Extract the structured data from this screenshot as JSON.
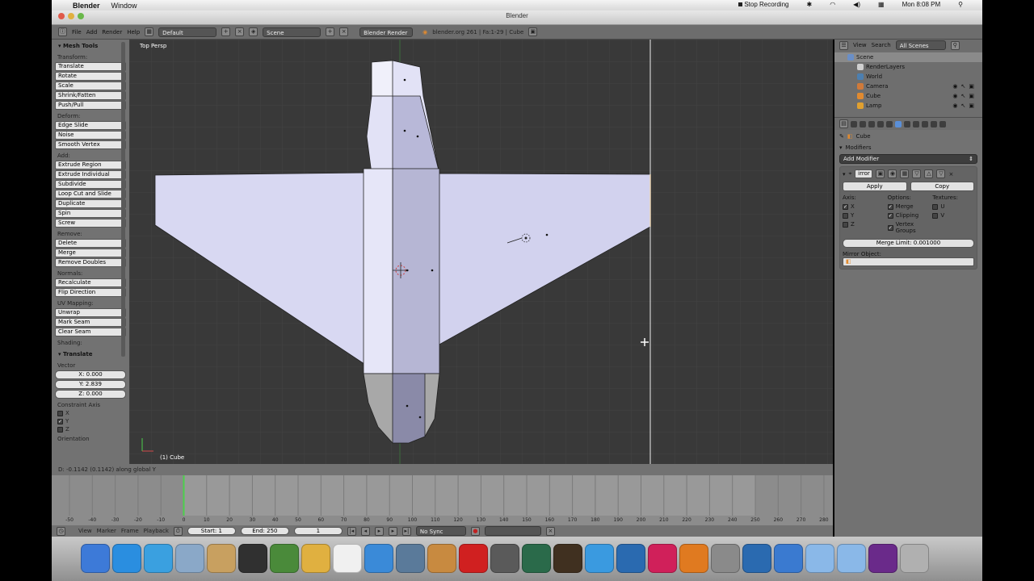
{
  "menubar": {
    "app": "Blender",
    "menu_window": "Window",
    "status": "Stop Recording",
    "clock": "Mon 8:08 PM"
  },
  "window": {
    "title": "Blender"
  },
  "info_header": {
    "menus": [
      "File",
      "Add",
      "Render",
      "Help"
    ],
    "screen_layout": "Default",
    "scene": "Scene",
    "render_engine": "Blender Render",
    "stats": "blender.org 261 | Fa:1-29 | Cube"
  },
  "toolshelf": {
    "panel_title": "Mesh Tools",
    "sections": [
      {
        "label": "Transform:",
        "buttons": [
          "Translate",
          "Rotate",
          "Scale",
          "Shrink/Fatten",
          "Push/Pull"
        ]
      },
      {
        "label": "Deform:",
        "buttons": [
          "Edge Slide",
          "Noise",
          "Smooth Vertex"
        ]
      },
      {
        "label": "Add:",
        "buttons": [
          "Extrude Region",
          "Extrude Individual",
          "Subdivide",
          "Loop Cut and Slide",
          "Duplicate",
          "Spin",
          "Screw"
        ]
      },
      {
        "label": "Remove:",
        "buttons": [
          "Delete",
          "Merge",
          "Remove Doubles"
        ]
      },
      {
        "label": "Normals:",
        "buttons": [
          "Recalculate",
          "Flip Direction"
        ]
      },
      {
        "label": "UV Mapping:",
        "buttons": [
          "Unwrap",
          "Mark Seam",
          "Clear Seam"
        ]
      },
      {
        "label": "Shading:",
        "buttons": []
      }
    ],
    "operator": {
      "title": "Translate",
      "vector_label": "Vector",
      "vector": [
        "X: 0.000",
        "Y: 2.839",
        "Z: 0.000"
      ],
      "constraint_label": "Constraint Axis",
      "constraints": [
        {
          "axis": "X",
          "checked": false
        },
        {
          "axis": "Y",
          "checked": true
        },
        {
          "axis": "Z",
          "checked": false
        }
      ],
      "orientation_label": "Orientation"
    }
  },
  "viewport": {
    "view_name": "Top Persp",
    "object_label": "(1) Cube"
  },
  "status": {
    "text": "D: -0.1142 (0.1142) along global Y"
  },
  "timeline": {
    "ticks": [
      "-50",
      "-40",
      "-30",
      "-20",
      "-10",
      "0",
      "10",
      "20",
      "30",
      "40",
      "50",
      "60",
      "70",
      "80",
      "90",
      "100",
      "110",
      "120",
      "130",
      "140",
      "150",
      "160",
      "170",
      "180",
      "190",
      "200",
      "210",
      "220",
      "230",
      "240",
      "250",
      "260",
      "270",
      "280"
    ],
    "current_frame": 0,
    "header": {
      "menus": [
        "View",
        "Marker",
        "Frame",
        "Playback"
      ],
      "start": "Start: 1",
      "end": "End: 250",
      "frame": "1",
      "sync": "No Sync"
    }
  },
  "outliner": {
    "menus": [
      "View",
      "Search"
    ],
    "filter": "All Scenes",
    "items": [
      {
        "name": "Scene",
        "icon_color": "#6a8fc8",
        "selected": true
      },
      {
        "name": "RenderLayers",
        "icon_color": "#d0d0d0",
        "selected": false
      },
      {
        "name": "World",
        "icon_color": "#4c7fb0",
        "selected": false
      },
      {
        "name": "Camera",
        "icon_color": "#d07a3a",
        "selected": false
      },
      {
        "name": "Cube",
        "icon_color": "#e08a30",
        "selected": false
      },
      {
        "name": "Lamp",
        "icon_color": "#e0a030",
        "selected": false
      }
    ]
  },
  "properties": {
    "breadcrumb": "Cube",
    "panel": "Modifiers",
    "add_modifier": "Add Modifier",
    "modifier_name": "irror",
    "apply": "Apply",
    "copy": "Copy",
    "axis_label": "Axis:",
    "options_label": "Options:",
    "textures_label": "Textures:",
    "axis": [
      {
        "name": "X",
        "checked": true
      },
      {
        "name": "Y",
        "checked": false
      },
      {
        "name": "Z",
        "checked": false
      }
    ],
    "options": [
      {
        "name": "Merge",
        "checked": true
      },
      {
        "name": "Clipping",
        "checked": true
      },
      {
        "name": "Vertex Groups",
        "checked": true
      }
    ],
    "textures": [
      {
        "name": "U",
        "checked": false
      },
      {
        "name": "V",
        "checked": false
      }
    ],
    "merge_limit": "Merge Limit: 0.001000",
    "mirror_object_label": "Mirror Object:"
  },
  "dock": {
    "icons": [
      {
        "name": "finder-icon",
        "color": "#3d7ad8"
      },
      {
        "name": "app-store-icon",
        "color": "#2a8ee0"
      },
      {
        "name": "safari-icon",
        "color": "#3aa0e0"
      },
      {
        "name": "mail-icon",
        "color": "#8aa8c8"
      },
      {
        "name": "preview-icon",
        "color": "#c8a060"
      },
      {
        "name": "dashboard-icon",
        "color": "#303030"
      },
      {
        "name": "facetime-icon",
        "color": "#4a8a3a"
      },
      {
        "name": "notes-icon",
        "color": "#e0b040"
      },
      {
        "name": "calendar-icon",
        "color": "#f0f0f0"
      },
      {
        "name": "itunes-icon",
        "color": "#3a8ad8"
      },
      {
        "name": "iphoto-icon",
        "color": "#5a7a9a"
      },
      {
        "name": "garageband-icon",
        "color": "#c88a40"
      },
      {
        "name": "flashcard-icon",
        "color": "#d02020"
      },
      {
        "name": "imovie-icon",
        "color": "#5a5a5a"
      },
      {
        "name": "time-machine-icon",
        "color": "#2a6a4a"
      },
      {
        "name": "game-icon",
        "color": "#403020"
      },
      {
        "name": "app-icon",
        "color": "#3a9ae0"
      },
      {
        "name": "web-icon",
        "color": "#2a6ab0"
      },
      {
        "name": "m-app-icon",
        "color": "#d0205a"
      },
      {
        "name": "blender-icon",
        "color": "#e07a20"
      },
      {
        "name": "system-preferences-icon",
        "color": "#8a8a8a"
      },
      {
        "name": "quicktime-icon",
        "color": "#2a6ab0"
      },
      {
        "name": "sync-icon",
        "color": "#3a7ad0"
      },
      {
        "name": "folder-icon",
        "color": "#8ab8e8"
      },
      {
        "name": "downloads-folder-icon",
        "color": "#8ab8e8"
      },
      {
        "name": "comic-icon",
        "color": "#6a2a8a"
      },
      {
        "name": "trash-icon",
        "color": "#b0b0b0"
      }
    ]
  }
}
